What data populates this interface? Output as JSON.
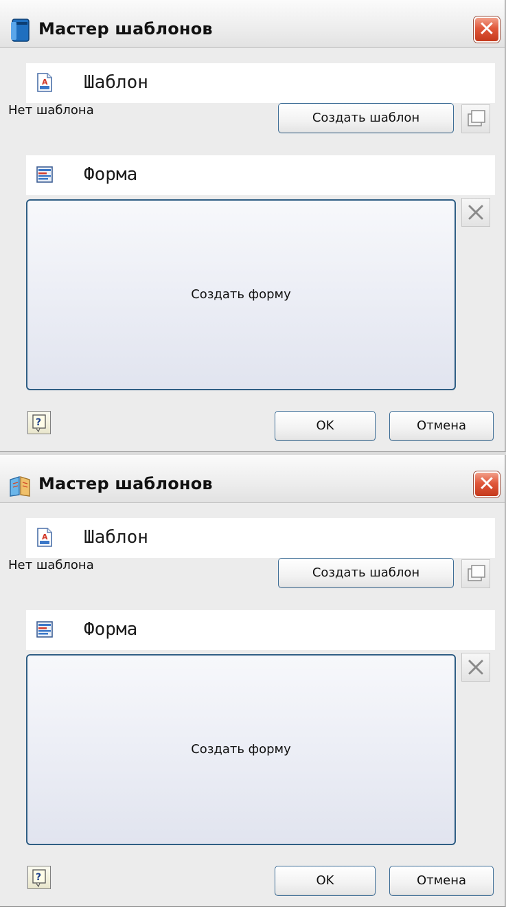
{
  "dialogs": [
    {
      "title": "Мастер шаблонов",
      "app_icon": "blue-book-icon",
      "template_section": {
        "title": "Шаблон",
        "icon": "document-template-icon",
        "status": "Нет шаблона",
        "create_label": "Создать шаблон",
        "copy_icon": "copy-icon"
      },
      "form_section": {
        "title": "Форма",
        "icon": "form-icon",
        "create_label": "Создать форму",
        "delete_icon": "close-x-icon"
      },
      "footer": {
        "help_icon": "help-icon",
        "ok_label": "OK",
        "cancel_label": "Отмена"
      },
      "close_glyph": "✕"
    },
    {
      "title": "Мастер шаблонов",
      "app_icon": "open-book-icon",
      "template_section": {
        "title": "Шаблон",
        "icon": "document-template-icon",
        "status": "Нет шаблона",
        "create_label": "Создать шаблон",
        "copy_icon": "copy-icon"
      },
      "form_section": {
        "title": "Форма",
        "icon": "form-icon",
        "create_label": "Создать форму",
        "delete_icon": "close-x-icon"
      },
      "footer": {
        "help_icon": "help-icon",
        "ok_label": "OK",
        "cancel_label": "Отмена"
      },
      "close_glyph": "✕"
    }
  ],
  "colors": {
    "close_button": "#d9462a",
    "button_border": "#3d6d96",
    "form_border": "#2f5e84"
  }
}
